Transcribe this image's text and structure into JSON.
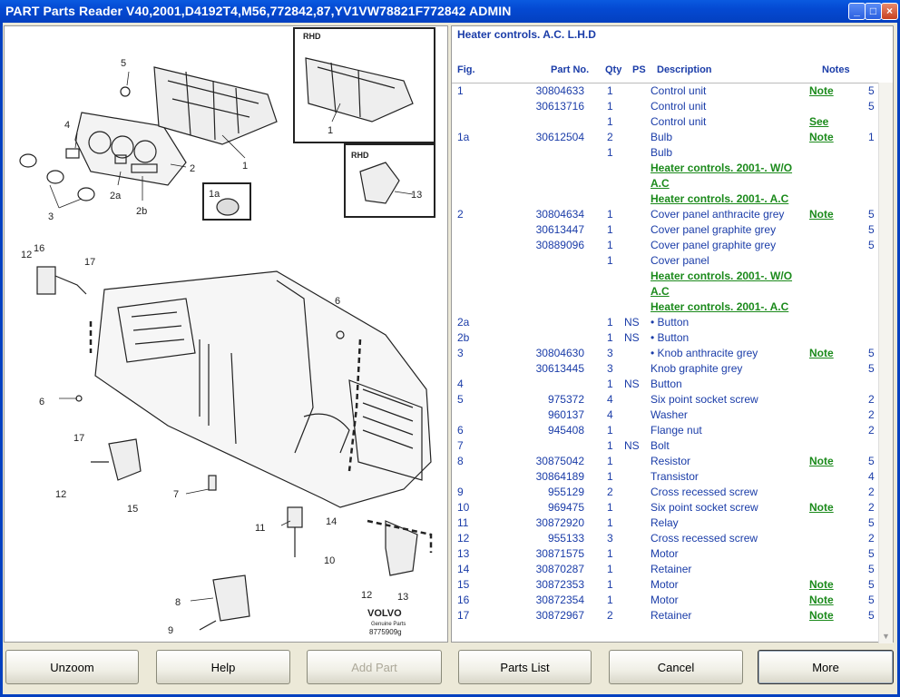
{
  "window": {
    "title": "PART Parts Reader V40,2001,D4192T4,M56,772842,87,YV1VW78821F772842 ADMIN"
  },
  "diagram": {
    "inset_rhd": "RHD",
    "inset_rhd2": "RHD",
    "brand": "VOLVO",
    "brand_sub": "Genuine Parts",
    "drawing_no": "8775909g",
    "callouts": [
      "5",
      "4",
      "1",
      "2",
      "2a",
      "2b",
      "3",
      "1a",
      "1",
      "13",
      "16",
      "12",
      "17",
      "6",
      "6",
      "17",
      "12",
      "15",
      "7",
      "11",
      "14",
      "10",
      "8",
      "9",
      "12",
      "13"
    ]
  },
  "header": {
    "title": "Heater controls. A.C. L.H.D",
    "col_fig": "Fig.",
    "col_part": "Part No.",
    "col_qty": "Qty",
    "col_ps": "PS",
    "col_desc": "Description",
    "col_notes": "Notes"
  },
  "rows": [
    {
      "fig": "1",
      "part": "30804633",
      "qty": "1",
      "ps": "",
      "desc": "Control unit",
      "note": "Note",
      "num": "5"
    },
    {
      "fig": "",
      "part": "30613716",
      "qty": "1",
      "ps": "",
      "desc": "Control unit",
      "note": "",
      "num": "5"
    },
    {
      "fig": "",
      "part": "",
      "qty": "1",
      "ps": "",
      "desc": "Control unit",
      "note": "See",
      "num": ""
    },
    {
      "fig": "1a",
      "part": "30612504",
      "qty": "2",
      "ps": "",
      "desc": "Bulb",
      "note": "Note",
      "num": "1"
    },
    {
      "fig": "",
      "part": "",
      "qty": "1",
      "ps": "",
      "desc": "Bulb",
      "note": "",
      "num": ""
    },
    {
      "fig": "",
      "part": "",
      "qty": "",
      "ps": "",
      "desc": "",
      "link": "Heater controls. 2001-. W/O",
      "note": "",
      "num": ""
    },
    {
      "fig": "",
      "part": "",
      "qty": "",
      "ps": "",
      "desc": "",
      "link": "A.C",
      "note": "",
      "num": ""
    },
    {
      "fig": "",
      "part": "",
      "qty": "",
      "ps": "",
      "desc": "",
      "link": "Heater controls. 2001-. A.C",
      "note": "",
      "num": ""
    },
    {
      "fig": "2",
      "part": "30804634",
      "qty": "1",
      "ps": "",
      "desc": "Cover panel anthracite grey",
      "note": "Note",
      "num": "5"
    },
    {
      "fig": "",
      "part": "30613447",
      "qty": "1",
      "ps": "",
      "desc": "Cover panel graphite grey",
      "note": "",
      "num": "5"
    },
    {
      "fig": "",
      "part": "30889096",
      "qty": "1",
      "ps": "",
      "desc": "Cover panel graphite grey",
      "note": "",
      "num": "5"
    },
    {
      "fig": "",
      "part": "",
      "qty": "1",
      "ps": "",
      "desc": "Cover panel",
      "note": "",
      "num": ""
    },
    {
      "fig": "",
      "part": "",
      "qty": "",
      "ps": "",
      "desc": "",
      "link": "Heater controls. 2001-. W/O",
      "note": "",
      "num": ""
    },
    {
      "fig": "",
      "part": "",
      "qty": "",
      "ps": "",
      "desc": "",
      "link": "A.C",
      "note": "",
      "num": ""
    },
    {
      "fig": "",
      "part": "",
      "qty": "",
      "ps": "",
      "desc": "",
      "link": "Heater controls. 2001-. A.C",
      "note": "",
      "num": ""
    },
    {
      "fig": "2a",
      "part": "",
      "qty": "1",
      "ps": "NS",
      "desc": "• Button",
      "note": "",
      "num": ""
    },
    {
      "fig": "2b",
      "part": "",
      "qty": "1",
      "ps": "NS",
      "desc": "• Button",
      "note": "",
      "num": ""
    },
    {
      "fig": "3",
      "part": "30804630",
      "qty": "3",
      "ps": "",
      "desc": "• Knob anthracite grey",
      "note": "Note",
      "num": "5"
    },
    {
      "fig": "",
      "part": "30613445",
      "qty": "3",
      "ps": "",
      "desc": "Knob graphite grey",
      "note": "",
      "num": "5"
    },
    {
      "fig": "4",
      "part": "",
      "qty": "1",
      "ps": "NS",
      "desc": "Button",
      "note": "",
      "num": ""
    },
    {
      "fig": "5",
      "part": "975372",
      "qty": "4",
      "ps": "",
      "desc": "Six point socket screw",
      "note": "",
      "num": "2"
    },
    {
      "fig": "",
      "part": "960137",
      "qty": "4",
      "ps": "",
      "desc": "Washer",
      "note": "",
      "num": "2"
    },
    {
      "fig": "6",
      "part": "945408",
      "qty": "1",
      "ps": "",
      "desc": "Flange nut",
      "note": "",
      "num": "2"
    },
    {
      "fig": "7",
      "part": "",
      "qty": "1",
      "ps": "NS",
      "desc": "Bolt",
      "note": "",
      "num": ""
    },
    {
      "fig": "8",
      "part": "30875042",
      "qty": "1",
      "ps": "",
      "desc": "Resistor",
      "note": "Note",
      "num": "5"
    },
    {
      "fig": "",
      "part": "30864189",
      "qty": "1",
      "ps": "",
      "desc": "Transistor",
      "note": "",
      "num": "4"
    },
    {
      "fig": "9",
      "part": "955129",
      "qty": "2",
      "ps": "",
      "desc": "Cross recessed screw",
      "note": "",
      "num": "2"
    },
    {
      "fig": "10",
      "part": "969475",
      "qty": "1",
      "ps": "",
      "desc": "Six point socket screw",
      "note": "Note",
      "num": "2"
    },
    {
      "fig": "11",
      "part": "30872920",
      "qty": "1",
      "ps": "",
      "desc": "Relay",
      "note": "",
      "num": "5"
    },
    {
      "fig": "12",
      "part": "955133",
      "qty": "3",
      "ps": "",
      "desc": "Cross recessed screw",
      "note": "",
      "num": "2"
    },
    {
      "fig": "13",
      "part": "30871575",
      "qty": "1",
      "ps": "",
      "desc": "Motor",
      "note": "",
      "num": "5"
    },
    {
      "fig": "14",
      "part": "30870287",
      "qty": "1",
      "ps": "",
      "desc": "Retainer",
      "note": "",
      "num": "5"
    },
    {
      "fig": "15",
      "part": "30872353",
      "qty": "1",
      "ps": "",
      "desc": "Motor",
      "note": "Note",
      "num": "5"
    },
    {
      "fig": "16",
      "part": "30872354",
      "qty": "1",
      "ps": "",
      "desc": "Motor",
      "note": "Note",
      "num": "5"
    },
    {
      "fig": "17",
      "part": "30872967",
      "qty": "2",
      "ps": "",
      "desc": "Retainer",
      "note": "Note",
      "num": "5"
    }
  ],
  "buttons": {
    "unzoom": "Unzoom",
    "help": "Help",
    "add_part": "Add Part",
    "parts_list": "Parts List",
    "cancel": "Cancel",
    "more": "More"
  }
}
